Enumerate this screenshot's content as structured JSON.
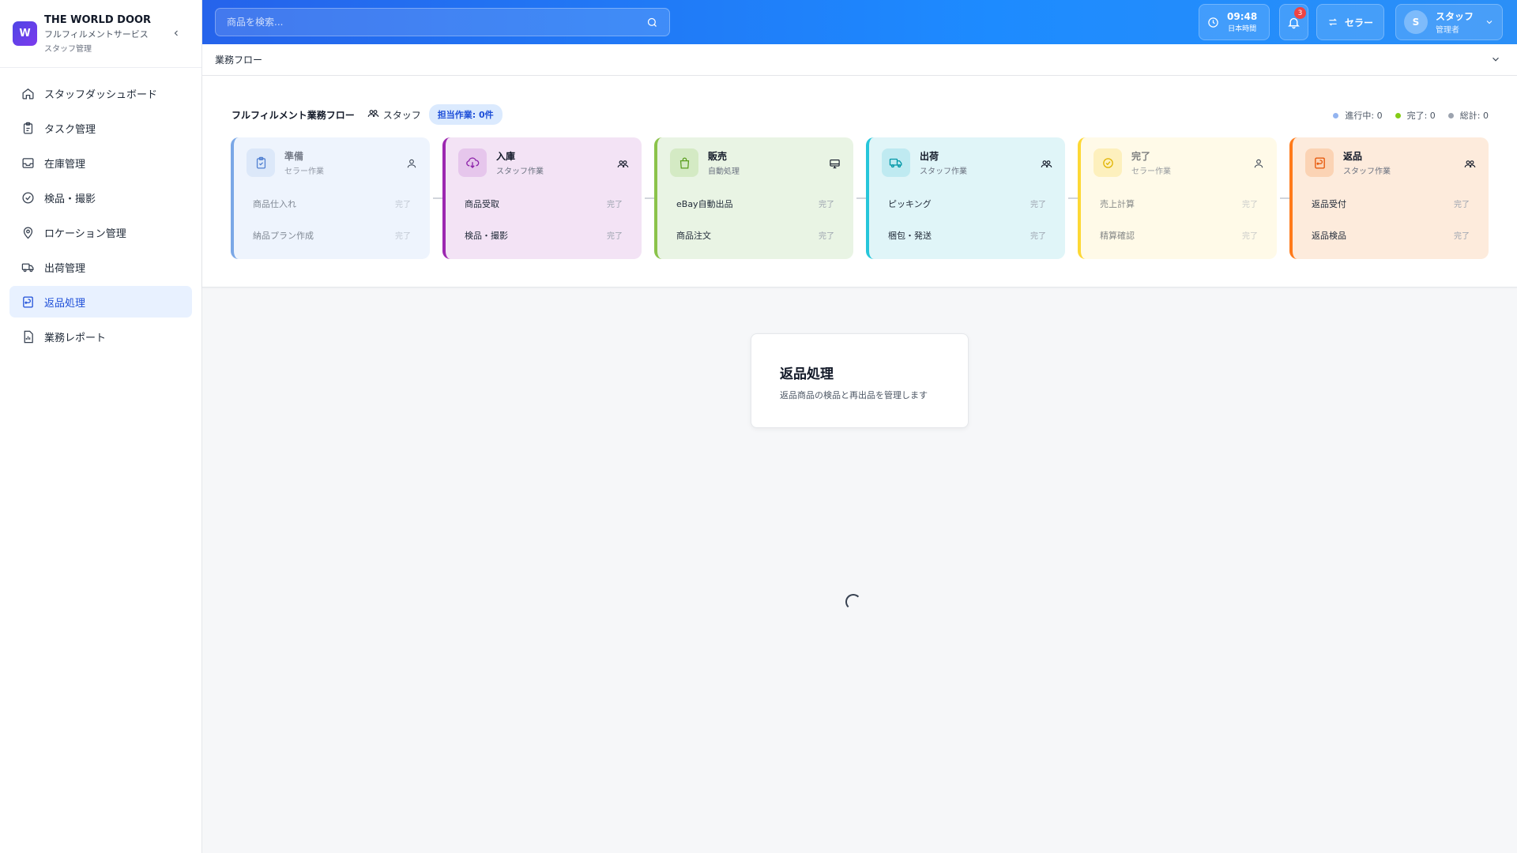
{
  "brand": {
    "logo_letter": "W",
    "name": "THE WORLD DOOR",
    "subtitle": "フルフィルメントサービス",
    "role": "スタッフ管理"
  },
  "sidebar": {
    "items": [
      {
        "label": "スタッフダッシュボード",
        "icon": "home-icon"
      },
      {
        "label": "タスク管理",
        "icon": "clipboard-icon"
      },
      {
        "label": "在庫管理",
        "icon": "inbox-icon"
      },
      {
        "label": "検品・撮影",
        "icon": "check-circle-icon"
      },
      {
        "label": "ロケーション管理",
        "icon": "map-pin-icon"
      },
      {
        "label": "出荷管理",
        "icon": "truck-icon"
      },
      {
        "label": "返品処理",
        "icon": "return-icon",
        "active": true
      },
      {
        "label": "業務レポート",
        "icon": "report-icon"
      }
    ]
  },
  "header": {
    "search_placeholder": "商品を検索...",
    "clock": {
      "time": "09:48",
      "zone": "日本時間"
    },
    "notifications": "3",
    "role_switch": "セラー",
    "user": {
      "initial": "S",
      "name": "スタッフ",
      "role": "管理者"
    }
  },
  "flow": {
    "bar_title": "業務フロー",
    "title": "フルフィルメント業務フロー",
    "staff_label": "スタッフ",
    "assigned": "担当作業: 0件",
    "legend": [
      {
        "label": "進行中: 0",
        "color": "#93b4f0"
      },
      {
        "label": "完了: 0",
        "color": "#84cc16"
      },
      {
        "label": "総計: 0",
        "color": "#9ca3af"
      }
    ],
    "stages": [
      {
        "name": "準備",
        "sub": "セラー作業",
        "icon": "clipboard-check-icon",
        "right_icon": "user-icon",
        "color": "#7aa7e6",
        "bg": "#eef4fd",
        "icbg": "#dce8f9",
        "dim": true,
        "tasks": [
          {
            "label": "商品仕入れ",
            "status": "完了"
          },
          {
            "label": "納品プラン作成",
            "status": "完了"
          }
        ]
      },
      {
        "name": "入庫",
        "sub": "スタッフ作業",
        "icon": "cloud-download-icon",
        "right_icon": "users-icon",
        "color": "#9c27b0",
        "bg": "#f3e3f5",
        "icbg": "#e6c6ec",
        "dim": false,
        "tasks": [
          {
            "label": "商品受取",
            "status": "完了"
          },
          {
            "label": "検品・撮影",
            "status": "完了"
          }
        ]
      },
      {
        "name": "販売",
        "sub": "自動処理",
        "icon": "shopping-bag-icon",
        "right_icon": "monitor-icon",
        "color": "#8bc34a",
        "bg": "#e9f4e4",
        "icbg": "#d4eac4",
        "dim": false,
        "tasks": [
          {
            "label": "eBay自動出品",
            "status": "完了"
          },
          {
            "label": "商品注文",
            "status": "完了"
          }
        ]
      },
      {
        "name": "出荷",
        "sub": "スタッフ作業",
        "icon": "truck-icon",
        "right_icon": "users-icon",
        "color": "#26c6da",
        "bg": "#e0f5f8",
        "icbg": "#bfeaf1",
        "dim": false,
        "tasks": [
          {
            "label": "ピッキング",
            "status": "完了"
          },
          {
            "label": "梱包・発送",
            "status": "完了"
          }
        ]
      },
      {
        "name": "完了",
        "sub": "セラー作業",
        "icon": "check-circle-icon",
        "right_icon": "user-icon",
        "color": "#fdd835",
        "bg": "#fffae8",
        "icbg": "#fdf0bd",
        "dim": true,
        "tasks": [
          {
            "label": "売上計算",
            "status": "完了"
          },
          {
            "label": "精算確認",
            "status": "完了"
          }
        ]
      },
      {
        "name": "返品",
        "sub": "スタッフ作業",
        "icon": "return-box-icon",
        "right_icon": "users-icon",
        "color": "#ff7a1a",
        "bg": "#fdebdc",
        "icbg": "#fbd3b4",
        "dim": false,
        "tasks": [
          {
            "label": "返品受付",
            "status": "完了"
          },
          {
            "label": "返品検品",
            "status": "完了"
          }
        ]
      }
    ]
  },
  "main": {
    "title": "返品処理",
    "description": "返品商品の検品と再出品を管理します"
  }
}
